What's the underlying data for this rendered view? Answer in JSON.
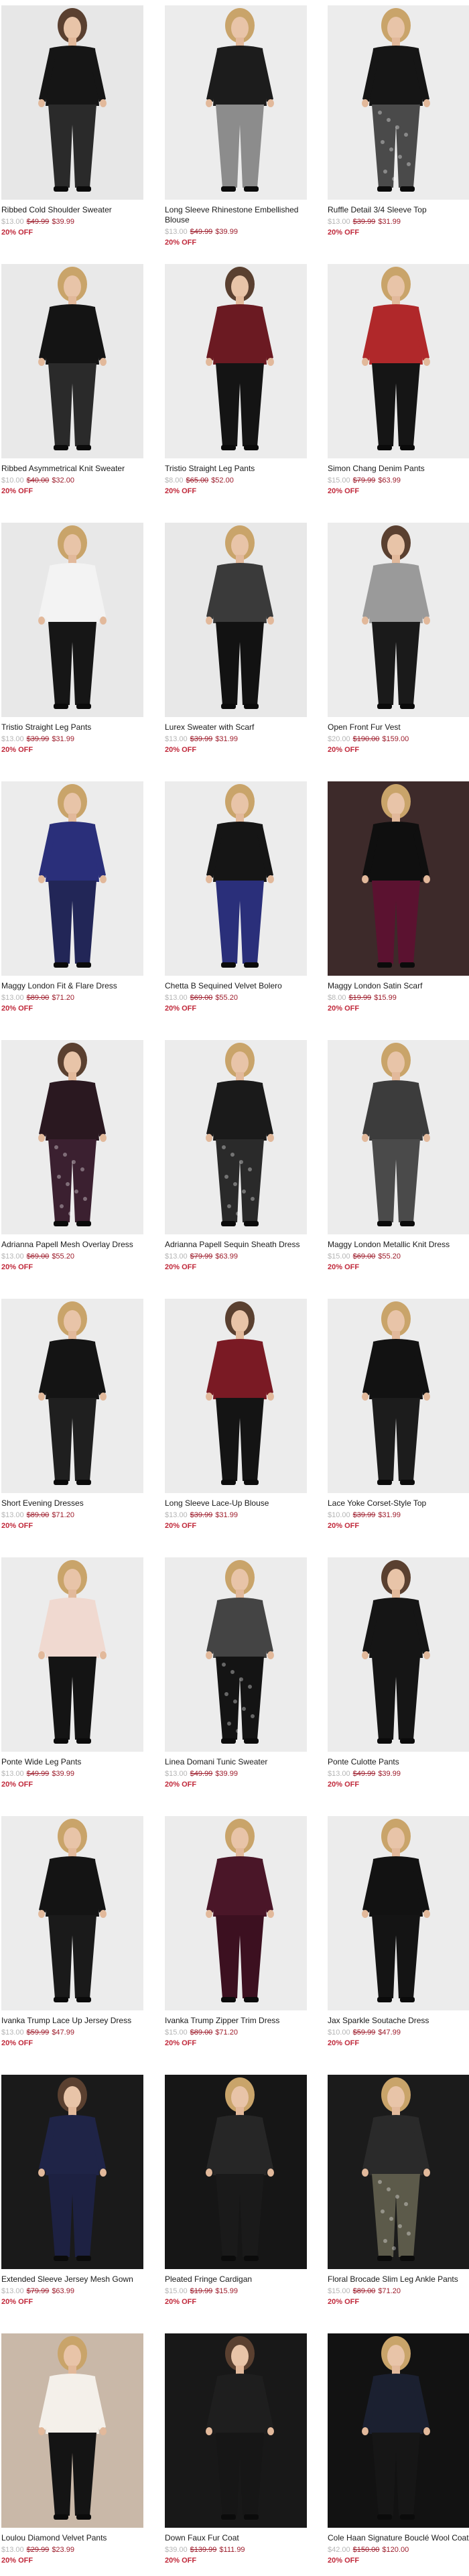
{
  "products": [
    {
      "title": "Ribbed Cold Shoulder Sweater",
      "orig": "$13.00",
      "was": "$49.99",
      "now": "$39.99",
      "off": "20% OFF",
      "bg": "#e7e7e7",
      "top": "#151515",
      "bottom": "#2a2a2a",
      "bottom_pattern": false
    },
    {
      "title": "Long Sleeve Rhinestone Embellished Blouse",
      "orig": "$13.00",
      "was": "$49.99",
      "now": "$39.99",
      "off": "20% OFF",
      "bg": "#ececec",
      "top": "#1c1c1c",
      "bottom": "#8c8c8c",
      "bottom_pattern": false
    },
    {
      "title": "Ruffle Detail 3/4 Sleeve Top",
      "orig": "$13.00",
      "was": "$39.99",
      "now": "$31.99",
      "off": "20% OFF",
      "bg": "#ececec",
      "top": "#151515",
      "bottom": "#4a4a4a",
      "bottom_pattern": true
    },
    {
      "title": "Ribbed Asymmetrical Knit Sweater",
      "orig": "$10.00",
      "was": "$40.00",
      "now": "$32.00",
      "off": "20% OFF",
      "bg": "#e9e9e9",
      "top": "#141414",
      "bottom": "#2a2a2a",
      "bottom_pattern": false
    },
    {
      "title": "Tristio Straight Leg Pants",
      "orig": "$8.00",
      "was": "$65.00",
      "now": "$52.00",
      "off": "20% OFF",
      "bg": "#ececec",
      "top": "#6b1a22",
      "bottom": "#141414",
      "bottom_pattern": false
    },
    {
      "title": "Simon Chang Denim Pants",
      "orig": "$15.00",
      "was": "$79.99",
      "now": "$63.99",
      "off": "20% OFF",
      "bg": "#ececec",
      "top": "#b0282a",
      "bottom": "#151515",
      "bottom_pattern": false
    },
    {
      "title": "Tristio Straight Leg Pants",
      "orig": "$13.00",
      "was": "$39.99",
      "now": "$31.99",
      "off": "20% OFF",
      "bg": "#e8e8e8",
      "top": "#f3f3f3",
      "bottom": "#161616",
      "bottom_pattern": false
    },
    {
      "title": "Lurex Sweater with Scarf",
      "orig": "$13.00",
      "was": "$39.99",
      "now": "$31.99",
      "off": "20% OFF",
      "bg": "#e8e8e8",
      "top": "#3a3a3a",
      "bottom": "#121212",
      "bottom_pattern": false
    },
    {
      "title": "Open Front Fur Vest",
      "orig": "$20.00",
      "was": "$190.00",
      "now": "$159.00",
      "off": "20% OFF",
      "bg": "#ececec",
      "top": "#9a9a9a",
      "bottom": "#1a1a1a",
      "bottom_pattern": false
    },
    {
      "title": "Maggy London Fit & Flare Dress",
      "orig": "$13.00",
      "was": "$89.00",
      "now": "$71.20",
      "off": "20% OFF",
      "bg": "#ececec",
      "top": "#2a2f7a",
      "bottom": "#222657",
      "bottom_pattern": false
    },
    {
      "title": "Chetta B Sequined Velvet Bolero",
      "orig": "$13.00",
      "was": "$69.00",
      "now": "$55.20",
      "off": "20% OFF",
      "bg": "#ececec",
      "top": "#151515",
      "bottom": "#2a2f7a",
      "bottom_pattern": false
    },
    {
      "title": "Maggy London Satin Scarf",
      "orig": "$8.00",
      "was": "$19.99",
      "now": "$15.99",
      "off": "20% OFF",
      "bg": "#3d2a2a",
      "top": "#0f0f0f",
      "bottom": "#5b1230",
      "bottom_pattern": false
    },
    {
      "title": "Adrianna Papell Mesh Overlay Dress",
      "orig": "$13.00",
      "was": "$69.00",
      "now": "$55.20",
      "off": "20% OFF",
      "bg": "#ececec",
      "top": "#2a1820",
      "bottom": "#3b2030",
      "bottom_pattern": true
    },
    {
      "title": "Adrianna Papell Sequin Sheath Dress",
      "orig": "$13.00",
      "was": "$79.99",
      "now": "$63.99",
      "off": "20% OFF",
      "bg": "#ececec",
      "top": "#1a1a1a",
      "bottom": "#2a2a2a",
      "bottom_pattern": true
    },
    {
      "title": "Maggy London Metallic Knit Dress",
      "orig": "$15.00",
      "was": "$69.00",
      "now": "$55.20",
      "off": "20% OFF",
      "bg": "#ececec",
      "top": "#3c3c3c",
      "bottom": "#4a4a4a",
      "bottom_pattern": false
    },
    {
      "title": "Short Evening Dresses",
      "orig": "$13.00",
      "was": "$89.00",
      "now": "$71.20",
      "off": "20% OFF",
      "bg": "#ececec",
      "top": "#141414",
      "bottom": "#1f1f1f",
      "bottom_pattern": false
    },
    {
      "title": "Long Sleeve Lace-Up Blouse",
      "orig": "$13.00",
      "was": "$39.99",
      "now": "$31.99",
      "off": "20% OFF",
      "bg": "#ececec",
      "top": "#7a1a24",
      "bottom": "#141414",
      "bottom_pattern": false
    },
    {
      "title": "Lace Yoke Corset-Style Top",
      "orig": "$10.00",
      "was": "$39.99",
      "now": "$31.99",
      "off": "20% OFF",
      "bg": "#ececec",
      "top": "#121212",
      "bottom": "#1c1c1c",
      "bottom_pattern": false
    },
    {
      "title": "Ponte Wide Leg Pants",
      "orig": "$13.00",
      "was": "$49.99",
      "now": "$39.99",
      "off": "20% OFF",
      "bg": "#ececec",
      "top": "#f0d9d0",
      "bottom": "#141414",
      "bottom_pattern": false
    },
    {
      "title": "Linea Domani Tunic Sweater",
      "orig": "$13.00",
      "was": "$49.99",
      "now": "$39.99",
      "off": "20% OFF",
      "bg": "#ececec",
      "top": "#444444",
      "bottom": "#141414",
      "bottom_pattern": true
    },
    {
      "title": "Ponte Culotte Pants",
      "orig": "$13.00",
      "was": "$49.99",
      "now": "$39.99",
      "off": "20% OFF",
      "bg": "#ececec",
      "top": "#151515",
      "bottom": "#151515",
      "bottom_pattern": false
    },
    {
      "title": "Ivanka Trump Lace Up Jersey Dress",
      "orig": "$13.00",
      "was": "$59.99",
      "now": "$47.99",
      "off": "20% OFF",
      "bg": "#ececec",
      "top": "#141414",
      "bottom": "#1a1a1a",
      "bottom_pattern": false
    },
    {
      "title": "Ivanka Trump Zipper Trim Dress",
      "orig": "$15.00",
      "was": "$89.00",
      "now": "$71.20",
      "off": "20% OFF",
      "bg": "#ececec",
      "top": "#4a1628",
      "bottom": "#3c1020",
      "bottom_pattern": false
    },
    {
      "title": "Jax Sparkle Soutache Dress",
      "orig": "$10.00",
      "was": "$59.99",
      "now": "$47.99",
      "off": "20% OFF",
      "bg": "#ececec",
      "top": "#121212",
      "bottom": "#141414",
      "bottom_pattern": false
    },
    {
      "title": "Extended Sleeve Jersey Mesh Gown",
      "orig": "$13.00",
      "was": "$79.99",
      "now": "$63.99",
      "off": "20% OFF",
      "bg": "#1a1a1a",
      "top": "#1f2447",
      "bottom": "#1d2142",
      "bottom_pattern": false
    },
    {
      "title": "Pleated Fringe Cardigan",
      "orig": "$15.00",
      "was": "$19.99",
      "now": "$15.99",
      "off": "20% OFF",
      "bg": "#161616",
      "top": "#262626",
      "bottom": "#1a1a1a",
      "bottom_pattern": false
    },
    {
      "title": "Floral Brocade Slim Leg Ankle Pants",
      "orig": "$15.00",
      "was": "$89.00",
      "now": "$71.20",
      "off": "20% OFF",
      "bg": "#1b1b1b",
      "top": "#2a2a2a",
      "bottom": "#5c5a4a",
      "bottom_pattern": true
    },
    {
      "title": "Loulou Diamond Velvet Pants",
      "orig": "$13.00",
      "was": "$29.99",
      "now": "$23.99",
      "off": "20% OFF",
      "bg": "#c9b8a8",
      "top": "#f4f0ea",
      "bottom": "#141414",
      "bottom_pattern": false
    },
    {
      "title": "Down Faux Fur Coat",
      "orig": "$39.00",
      "was": "$139.99",
      "now": "$111.99",
      "off": "20% OFF",
      "bg": "#181818",
      "top": "#1e1e1e",
      "bottom": "#161616",
      "bottom_pattern": false
    },
    {
      "title": "Cole Haan Signature Bouclé Wool Coat",
      "orig": "$42.00",
      "was": "$150.00",
      "now": "$120.00",
      "off": "20% OFF",
      "bg": "#121212",
      "top": "#1b2030",
      "bottom": "#161616",
      "bottom_pattern": false
    }
  ]
}
